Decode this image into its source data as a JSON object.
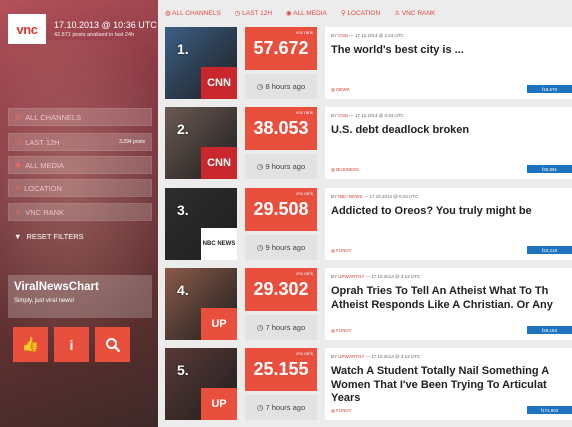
{
  "sidebar": {
    "logo": "vnc",
    "date": "17.10.2013 @ 10:36 UTC",
    "posts_analysed": "42.871 posts analised in last 24h",
    "filters": [
      {
        "icon": "globe-icon",
        "label": "ALL CHANNELS",
        "count": ""
      },
      {
        "icon": "clock-icon",
        "label": "LAST 12H",
        "count": "3.294 posts"
      },
      {
        "icon": "media-icon",
        "label": "ALL MEDIA",
        "count": ""
      },
      {
        "icon": "pin-icon",
        "label": "LOCATION",
        "count": ""
      },
      {
        "icon": "rank-icon",
        "label": "VNC RANK",
        "count": ""
      }
    ],
    "reset_label": "RESET FILTERS",
    "brand_title": "ViralNewsChart",
    "brand_tagline": "Simply, just viral news!"
  },
  "topbar": [
    "ALL CHANNELS",
    "LAST 12H",
    "ALL MEDIA",
    "LOCATION",
    "VNC RANK"
  ],
  "rows": [
    {
      "rank": "1.",
      "source_logo": "CNN",
      "score": "57.672",
      "score_caption": "vnc rank",
      "time": "8 hours ago",
      "meta_src": "CNN",
      "meta_date": "17.10.2013 @ 2:23 UTC",
      "headline": "The world's best city is ...",
      "headline2": "",
      "headline3": "",
      "category": "NEWS",
      "shares": "16,570",
      "img_color": "#3c5f86",
      "logo_color": "#c8272d"
    },
    {
      "rank": "2.",
      "source_logo": "CNN",
      "score": "38.053",
      "score_caption": "vnc rank",
      "time": "9 hours ago",
      "meta_src": "CNN",
      "meta_date": "17.10.2013 @ 0:43 UTC",
      "headline": "U.S. debt deadlock broken",
      "headline2": "",
      "headline3": "",
      "category": "BUSINESS",
      "shares": "30,861",
      "img_color": "#6b5a52",
      "logo_color": "#c8272d"
    },
    {
      "rank": "3.",
      "source_logo": "NBC NEWS",
      "score": "29.508",
      "score_caption": "vnc rank",
      "time": "9 hours ago",
      "meta_src": "NBC NEWS",
      "meta_date": "17.10.2013 @ 0:43 UTC",
      "headline": "Addicted to Oreos? You truly might be",
      "headline2": "",
      "headline3": "",
      "category": "FUNNY",
      "shares": "23,218",
      "img_color": "#2e2e2e",
      "logo_color": "#ffffff"
    },
    {
      "rank": "4.",
      "source_logo": "UP",
      "score": "29.302",
      "score_caption": "vnc rank",
      "time": "7 hours ago",
      "meta_src": "UPWORTHY",
      "meta_date": "17.10.2013 @ 3:13 UTC",
      "headline": "Oprah Tries To Tell An Atheist What To Th",
      "headline2": "Atheist Responds Like A Christian. Or Any",
      "headline3": "",
      "category": "FUNNY",
      "shares": "29,163",
      "img_color": "#8a5a4a",
      "logo_color": "#e84f3d"
    },
    {
      "rank": "5.",
      "source_logo": "UP",
      "score": "25.155",
      "score_caption": "vnc rank",
      "time": "7 hours ago",
      "meta_src": "UPWORTHY",
      "meta_date": "17.10.2013 @ 3:13 UTC",
      "headline": "Watch A Student Totally Nail Something A",
      "headline2": "Women That I've Been Trying To Articulat",
      "headline3": "Years",
      "category": "FUNNY",
      "shares": "174,903",
      "img_color": "#5a3a36",
      "logo_color": "#e84f3d"
    }
  ]
}
